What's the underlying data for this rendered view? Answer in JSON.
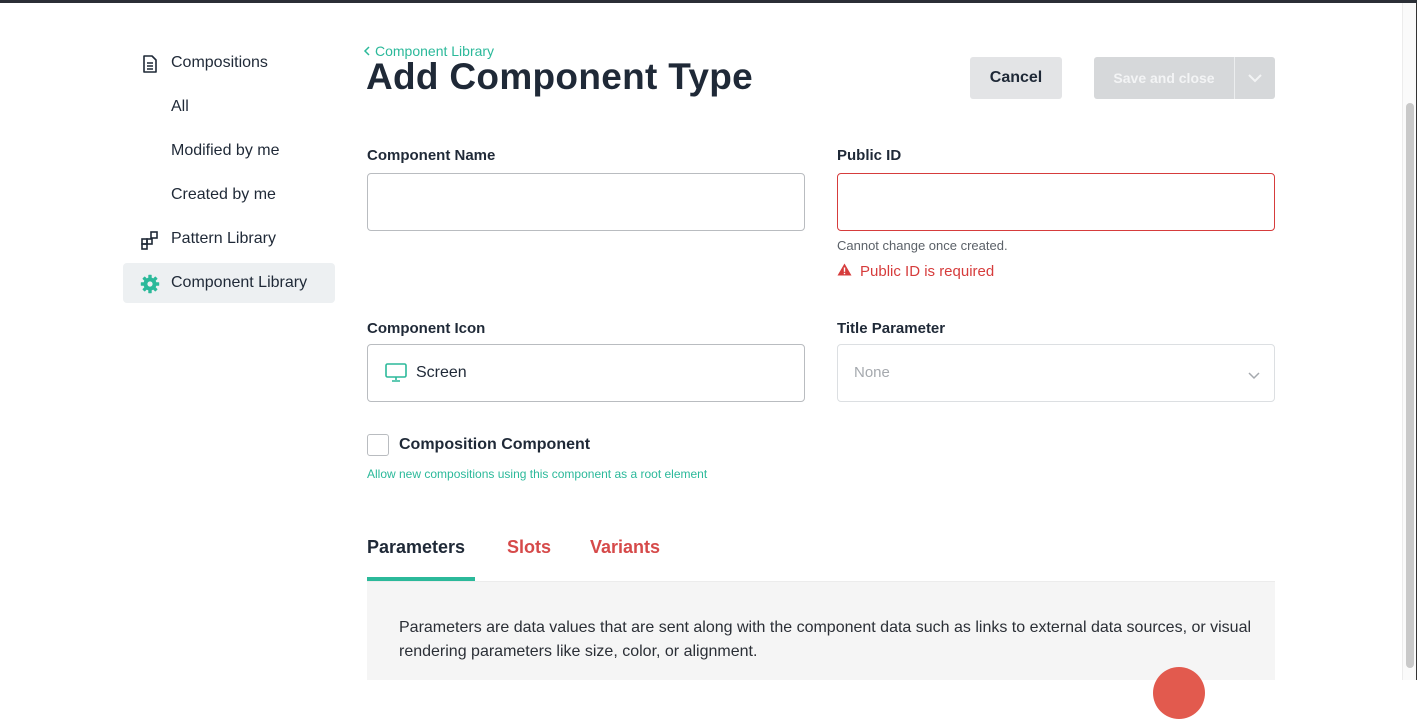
{
  "sidebar": {
    "items": [
      {
        "label": "Compositions",
        "icon": "document-icon",
        "active": false
      },
      {
        "label": "All",
        "active": false
      },
      {
        "label": "Modified by me",
        "active": false
      },
      {
        "label": "Created by me",
        "active": false
      },
      {
        "label": "Pattern Library",
        "icon": "pattern-icon",
        "active": false
      },
      {
        "label": "Component Library",
        "icon": "gear-icon",
        "active": true
      }
    ]
  },
  "header": {
    "breadcrumb": "Component Library",
    "title": "Add Component Type",
    "cancel_label": "Cancel",
    "save_label": "Save and close"
  },
  "form": {
    "component_name": {
      "label": "Component Name",
      "value": ""
    },
    "public_id": {
      "label": "Public ID",
      "value": "",
      "hint": "Cannot change once created.",
      "error": "Public ID is required"
    },
    "component_icon": {
      "label": "Component Icon",
      "value": "Screen",
      "icon": "screen-icon"
    },
    "title_parameter": {
      "label": "Title Parameter",
      "placeholder": "None"
    },
    "composition_component": {
      "label": "Composition Component",
      "checked": false,
      "help": "Allow new compositions using this component as a root element"
    }
  },
  "tabs": [
    {
      "label": "Parameters",
      "active": true,
      "error": false
    },
    {
      "label": "Slots",
      "active": false,
      "error": true
    },
    {
      "label": "Variants",
      "active": false,
      "error": true
    }
  ],
  "panel": {
    "text": "Parameters are data values that are sent along with the component data such as links to external data sources, or visual rendering parameters like size, color, or alignment."
  },
  "colors": {
    "accent": "#2bb99a",
    "error": "#d63c3c",
    "text": "#1f2937"
  }
}
